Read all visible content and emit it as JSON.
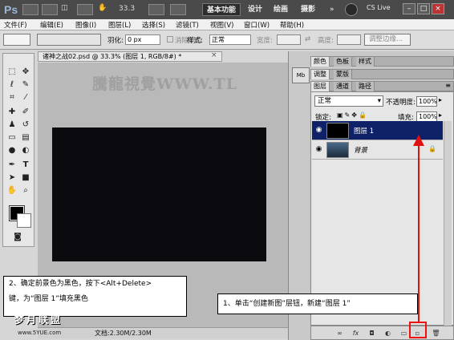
{
  "app": {
    "logo": "Ps",
    "zoom": "33.3",
    "cs_live": "CS Live"
  },
  "workspaces": [
    "基本功能",
    "设计",
    "绘画",
    "摄影"
  ],
  "window_buttons": [
    "–",
    "□",
    "×"
  ],
  "menu": [
    "文件(F)",
    "编辑(E)",
    "图像(I)",
    "图层(L)",
    "选择(S)",
    "滤镜(T)",
    "视图(V)",
    "窗口(W)",
    "帮助(H)"
  ],
  "options": {
    "feather_label": "羽化:",
    "feather_value": "0 px",
    "antialias": "消除锯齿",
    "style_label": "样式:",
    "style_value": "正常",
    "width_label": "宽度:",
    "height_label": "高度:",
    "refine": "调整边缘..."
  },
  "document": {
    "tab_title": "诸神之战02.psd @ 33.3% (图层 1, RGB/8#) *",
    "close": "×",
    "watermark": "騰龍視覺WWW.TL",
    "status": "文档:2.30M/2.30M"
  },
  "panels": {
    "top_tabs": [
      "颜色",
      "色板",
      "样式"
    ],
    "mid_tabs": [
      "调整",
      "蒙版"
    ],
    "layer_tabs": [
      "图层",
      "通道",
      "路径"
    ],
    "blend_mode": "正常",
    "opacity_label": "不透明度:",
    "opacity_value": "100%",
    "lock_label": "锁定:",
    "fill_label": "填充:",
    "fill_value": "100%",
    "layers": [
      {
        "name": "图层 1",
        "selected": true
      },
      {
        "name": "背景",
        "selected": false
      }
    ]
  },
  "annotations": {
    "left_line1": "2、确定前景色为黑色，按下<Alt+Delete>",
    "left_line2": "键，为“图层 1”填充黑色",
    "right": "1、单击“创建新图”层钮，新建“图层 1”"
  },
  "brand": {
    "name": "梦月联盟",
    "url": "www.5YUE.com"
  },
  "colors": {
    "accent_red": "#e11111",
    "selected_layer": "#0f2268",
    "canvas": "#0a0a0f"
  }
}
